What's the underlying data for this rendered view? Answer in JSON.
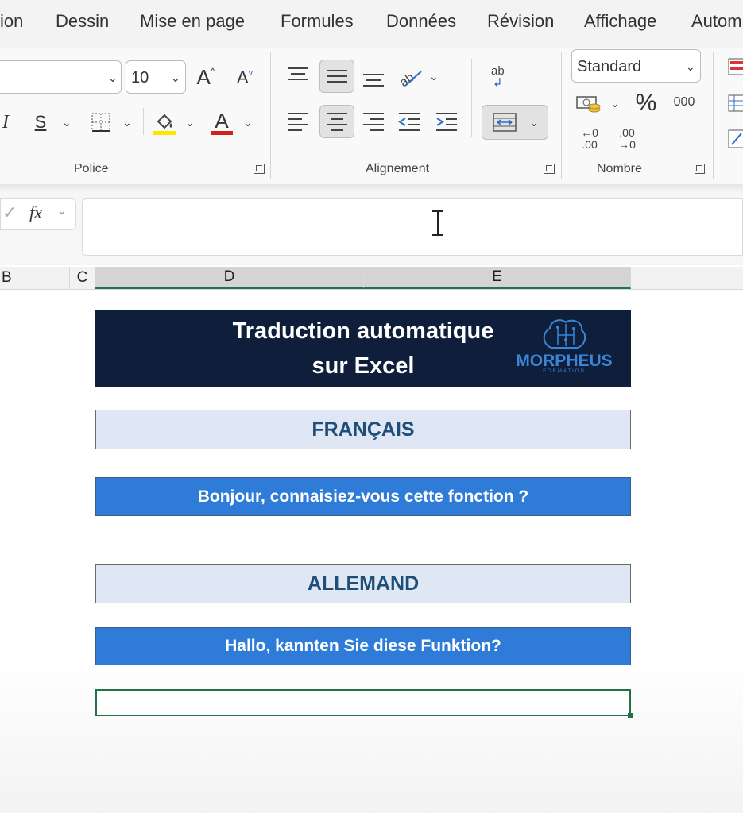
{
  "ribbon_tabs": [
    "ion",
    "Dessin",
    "Mise en page",
    "Formules",
    "Données",
    "Révision",
    "Affichage",
    "Autom"
  ],
  "font_group": {
    "label": "Police",
    "font_name_value": "",
    "font_size_value": "10",
    "grow_label": "A",
    "shrink_label": "A",
    "italic_label": "I",
    "strike_label": "S",
    "font_color_label": "A"
  },
  "alignment_group": {
    "label": "Alignement",
    "wrap_text_label": "ab"
  },
  "number_group": {
    "label": "Nombre",
    "format_value": "Standard",
    "percent_label": "%",
    "thousands_label": "000",
    "increase_decimal_label": "←0 .00",
    "decrease_decimal_label": ".00 →0"
  },
  "formula_bar": {
    "fx_label": "fx",
    "value": ""
  },
  "columns": [
    "B",
    "C",
    "D",
    "E"
  ],
  "sheet": {
    "title_line1": "Traduction automatique",
    "title_line2": "sur Excel",
    "logo_text": "MORPHEUS",
    "logo_subtext": "FORMATION",
    "french_header": "FRANÇAIS",
    "french_text": "Bonjour, connaisiez-vous cette fonction ?",
    "german_header": "ALLEMAND",
    "german_text": "Hallo, kannten Sie diese Funktion?",
    "active_cell_value": ""
  },
  "colors": {
    "title_bg": "#0f1e3a",
    "header_bg": "#dfe7f4",
    "header_text": "#1f4e79",
    "text_bg": "#2f7bd8",
    "excel_green": "#217346"
  }
}
